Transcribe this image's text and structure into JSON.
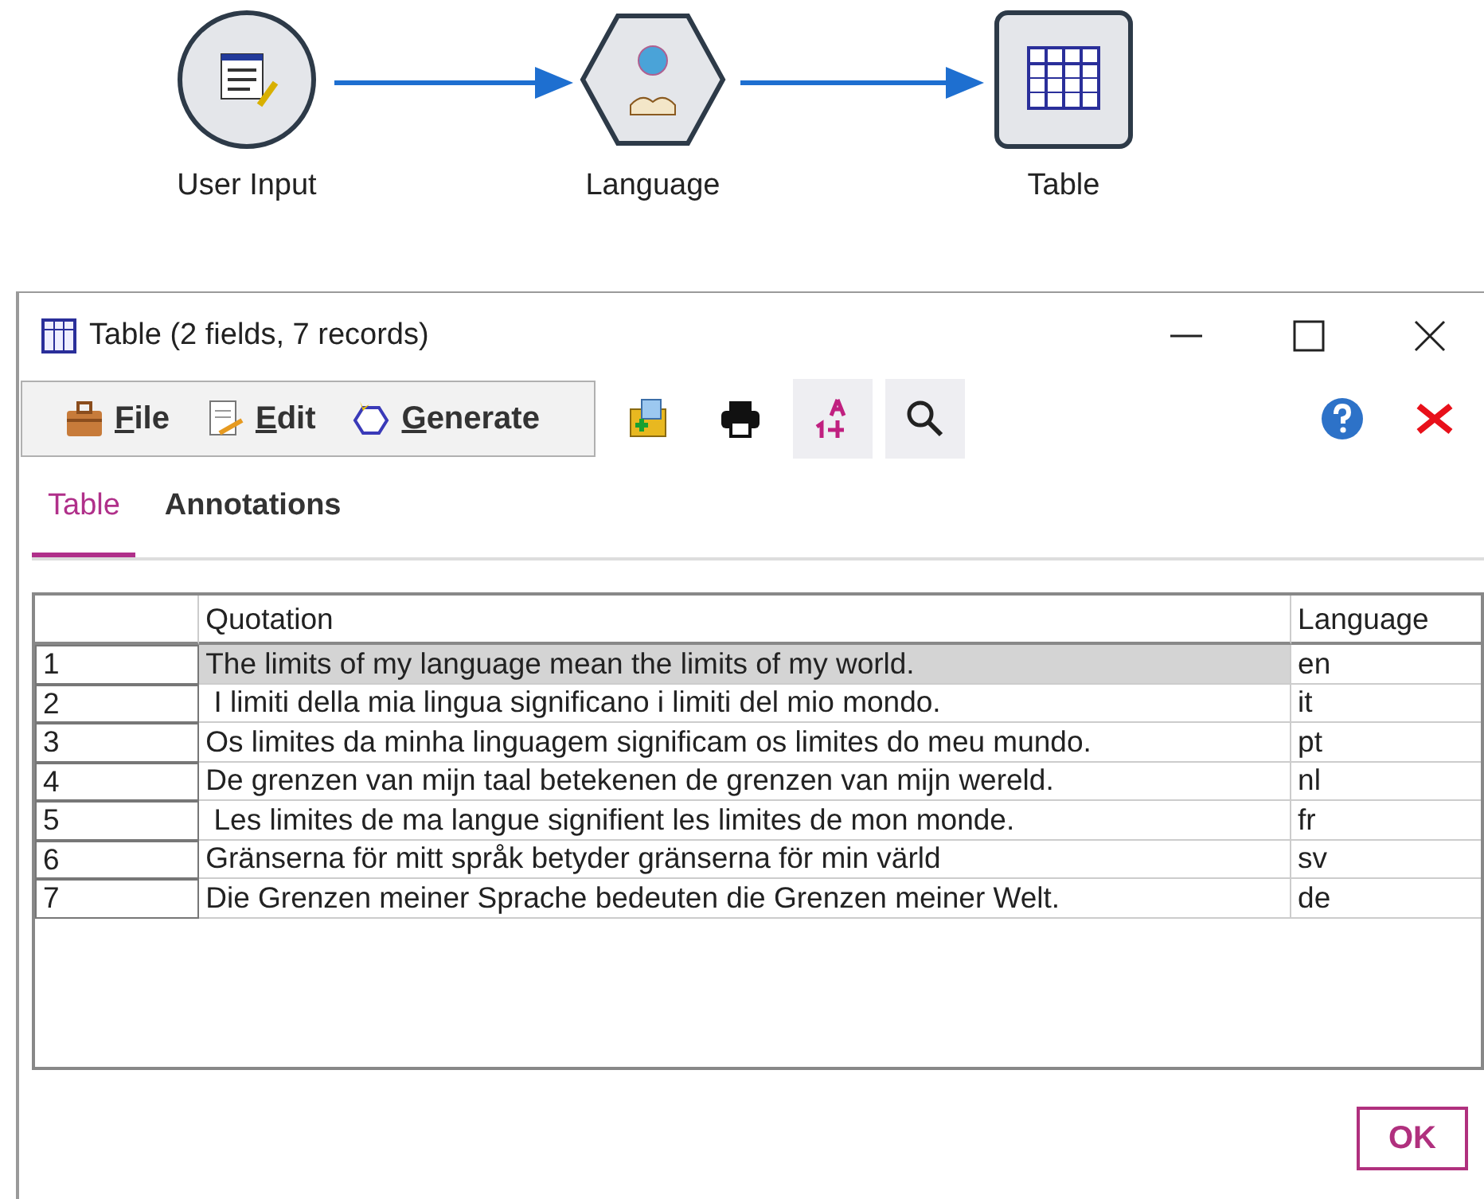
{
  "flow": {
    "nodes": [
      {
        "kind": "input",
        "label": "User Input"
      },
      {
        "kind": "process",
        "label": "Language"
      },
      {
        "kind": "output",
        "label": "Table"
      }
    ]
  },
  "window": {
    "title": "Table (2 fields, 7 records)"
  },
  "menus": [
    {
      "kind": "file",
      "label": "File"
    },
    {
      "kind": "edit",
      "label": "Edit"
    },
    {
      "kind": "generate",
      "label": "Generate"
    }
  ],
  "tabs": [
    {
      "label": "Table",
      "selected": true
    },
    {
      "label": "Annotations",
      "selected": false
    }
  ],
  "table": {
    "columns": [
      "Quotation",
      "Language"
    ],
    "rows": [
      {
        "index": "1",
        "quotation": "The limits of my language mean the limits of my world.",
        "language": "en",
        "selected": true
      },
      {
        "index": "2",
        "quotation": " I limiti della mia lingua significano i limiti del mio mondo.",
        "language": "it",
        "selected": false
      },
      {
        "index": "3",
        "quotation": "Os limites da minha linguagem significam os limites do meu mundo.",
        "language": "pt",
        "selected": false
      },
      {
        "index": "4",
        "quotation": "De grenzen van mijn taal betekenen de grenzen van mijn wereld.",
        "language": "nl",
        "selected": false
      },
      {
        "index": "5",
        "quotation": " Les limites de ma langue signifient les limites de mon monde.",
        "language": "fr",
        "selected": false
      },
      {
        "index": "6",
        "quotation": "Gränserna för mitt språk betyder gränserna för min värld",
        "language": "sv",
        "selected": false
      },
      {
        "index": "7",
        "quotation": "Die Grenzen meiner Sprache bedeuten die Grenzen meiner Welt.",
        "language": "de",
        "selected": false
      }
    ]
  },
  "buttons": [
    "OK"
  ]
}
